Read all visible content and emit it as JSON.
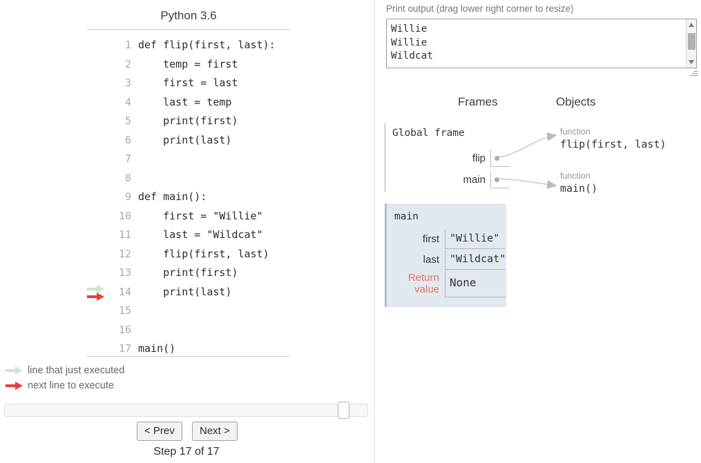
{
  "code_panel": {
    "title": "Python 3.6",
    "lines": [
      {
        "n": "1",
        "text": "def flip(first, last):",
        "arrow": "none"
      },
      {
        "n": "2",
        "text": "    temp = first",
        "arrow": "none"
      },
      {
        "n": "3",
        "text": "    first = last",
        "arrow": "none"
      },
      {
        "n": "4",
        "text": "    last = temp",
        "arrow": "none"
      },
      {
        "n": "5",
        "text": "    print(first)",
        "arrow": "none"
      },
      {
        "n": "6",
        "text": "    print(last)",
        "arrow": "none"
      },
      {
        "n": "7",
        "text": "",
        "arrow": "none"
      },
      {
        "n": "8",
        "text": "",
        "arrow": "none"
      },
      {
        "n": "9",
        "text": "def main():",
        "arrow": "none"
      },
      {
        "n": "10",
        "text": "    first = \"Willie\"",
        "arrow": "none"
      },
      {
        "n": "11",
        "text": "    last = \"Wildcat\"",
        "arrow": "none"
      },
      {
        "n": "12",
        "text": "    flip(first, last)",
        "arrow": "none"
      },
      {
        "n": "13",
        "text": "    print(first)",
        "arrow": "none"
      },
      {
        "n": "14",
        "text": "    print(last)",
        "arrow": "both"
      },
      {
        "n": "15",
        "text": "",
        "arrow": "none"
      },
      {
        "n": "16",
        "text": "",
        "arrow": "none"
      },
      {
        "n": "17",
        "text": "main()",
        "arrow": "none"
      }
    ]
  },
  "legend": {
    "executed_label": "line that just executed",
    "next_label": "next line to execute",
    "executed_color": "#c9e8c9",
    "next_color": "#e93f34"
  },
  "controls": {
    "prev_label": "< Prev",
    "next_label": "Next >",
    "step_label": "Step 17 of 17",
    "slider_value": 17,
    "slider_max": 17
  },
  "output": {
    "label": "Print output (drag lower right corner to resize)",
    "text": "Willie\nWillie\nWildcat"
  },
  "viz": {
    "frames_header": "Frames",
    "objects_header": "Objects",
    "global_frame": {
      "title": "Global frame",
      "vars": [
        {
          "name": "flip"
        },
        {
          "name": "main"
        }
      ]
    },
    "objects": [
      {
        "type": "function",
        "value": "flip(first, last)"
      },
      {
        "type": "function",
        "value": "main()"
      }
    ],
    "stack_frames": [
      {
        "title": "main",
        "rows": [
          {
            "name": "first",
            "value": "\"Willie\"",
            "is_return": false
          },
          {
            "name": "last",
            "value": "\"Wildcat\"",
            "is_return": false
          },
          {
            "name": "Return\nvalue",
            "name_line1": "Return",
            "name_line2": "value",
            "value": "None",
            "is_return": true
          }
        ]
      }
    ],
    "frame_bg_color": "#e2e8f0",
    "return_value_color": "#e8735f"
  }
}
